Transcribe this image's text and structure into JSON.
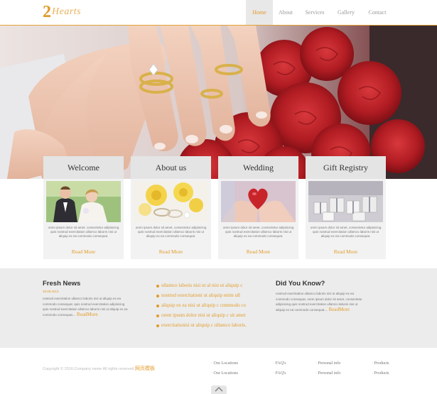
{
  "header": {
    "logo_mark": "2",
    "logo_text": "Hearts",
    "nav": [
      "Home",
      "About",
      "Services",
      "Gallery",
      "Contact"
    ]
  },
  "features": [
    {
      "title": "Welcome",
      "text": "orem ipsum dolor sit amet, consectetur adipisicing quis nostrud exercitation ullamco laboris nisi ut aliquip ex ea commodo consequat.",
      "more": "Read More",
      "image": "bride-and-groom"
    },
    {
      "title": "About us",
      "text": "orem ipsum dolor sit amet, consectetur adipisicing quis nostrud exercitation ullamco laboris nisi ut aliquip ex ea commodo consequat.",
      "more": "Read More",
      "image": "yellow-roses-and-rings"
    },
    {
      "title": "Wedding",
      "text": "orem ipsum dolor sit amet, consectetur adipisicing quis nostrud exercitation ullamco laboris nisi ut aliquip ex ea commodo consequat.",
      "more": "Read More",
      "image": "hands-holding-heart"
    },
    {
      "title": "Gift Registry",
      "text": "orem ipsum dolor sit amet, consectetur adipisicing quis nostrud exercitation ullamco laboris nisi ut aliquip ex ea commodo consequat.",
      "more": "Read More",
      "image": "gift-boxes"
    }
  ],
  "fresh_news": {
    "title": "Fresh News",
    "date": "28.08.2013",
    "text": "nostrud exercitation ullamco laboris nisi ut aliquip ex ea commodo consequat. quis nostrud exercitation adipisicing quis nostrud exercitation ullamco laboris nisi ut aliquip ex ea commodo consequat....",
    "more": "ReadMore"
  },
  "list": [
    "ullamco laboris nisi ut al nisi ut aliquip c",
    "nostrud exercitationi ut aliquip enim ull",
    "aliquip ex ea nisi ut aliquip c commodo co",
    "orem ipsum dolor nisi ut aliquip c sit amet",
    "exercitationisi ut aliquip c ullamco laboris."
  ],
  "did_you_know": {
    "title": "Did You Know?",
    "text": "nostrud exercitation ullamco laboris nisi ut aliquip ex ea commodo consequat. orem ipsum dolor sit amet, consectetur adipisicing quis nostrud exercitation ullamco laboris nisi ut aliquip ex ea commodo consequat....",
    "more": "ReadMore"
  },
  "footer": {
    "copyright": "Copyright © 2016.Company name All rights reserved",
    "copyright_link": "网页模板",
    "columns": [
      [
        "Our Locations",
        "Our Locations"
      ],
      [
        "FAQ's",
        "FAQ's"
      ],
      [
        "Personal info",
        "Personal info"
      ],
      [
        "Products",
        "Products"
      ]
    ]
  },
  "colors": {
    "accent": "#e29b29",
    "band": "#ececec",
    "feature_box": "#f2f2f2"
  }
}
